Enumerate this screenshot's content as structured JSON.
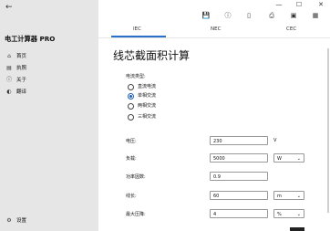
{
  "app": {
    "title": "电工计算器 PRO",
    "back": "←"
  },
  "nav": [
    {
      "icon": "⌂",
      "label": "首页"
    },
    {
      "icon": "▤",
      "label": "执照"
    },
    {
      "icon": "ⓘ",
      "label": "关于"
    },
    {
      "icon": "◐",
      "label": "翻译"
    }
  ],
  "settings": {
    "icon": "⚙",
    "label": "设置"
  },
  "window": {
    "minimize": "—",
    "maximize": "☐",
    "close": "✕"
  },
  "toolbar": [
    "save-icon",
    "info-icon",
    "document-icon",
    "print-icon",
    "image-icon",
    "grid-icon"
  ],
  "tabs": [
    "IEC",
    "NEC",
    "CEC"
  ],
  "page_title": "线芯截面积计算",
  "current_type": {
    "label": "电流类型:",
    "options": [
      "直流电流",
      "单相交流",
      "两相交流",
      "三相交流"
    ],
    "selected": 1
  },
  "fields": {
    "voltage": {
      "label": "电压:",
      "value": "230",
      "unit": "V"
    },
    "load": {
      "label": "负载:",
      "value": "5000",
      "unit": "W"
    },
    "power_factor": {
      "label": "功率因数:",
      "value": "0.9"
    },
    "length": {
      "label": "线长:",
      "value": "60",
      "unit": "m"
    },
    "max_drop": {
      "label": "最大压降:",
      "value": "4",
      "unit": "%"
    }
  },
  "colors": {
    "sidebar": "#e6e6e6",
    "accent": "#2a70c9"
  }
}
